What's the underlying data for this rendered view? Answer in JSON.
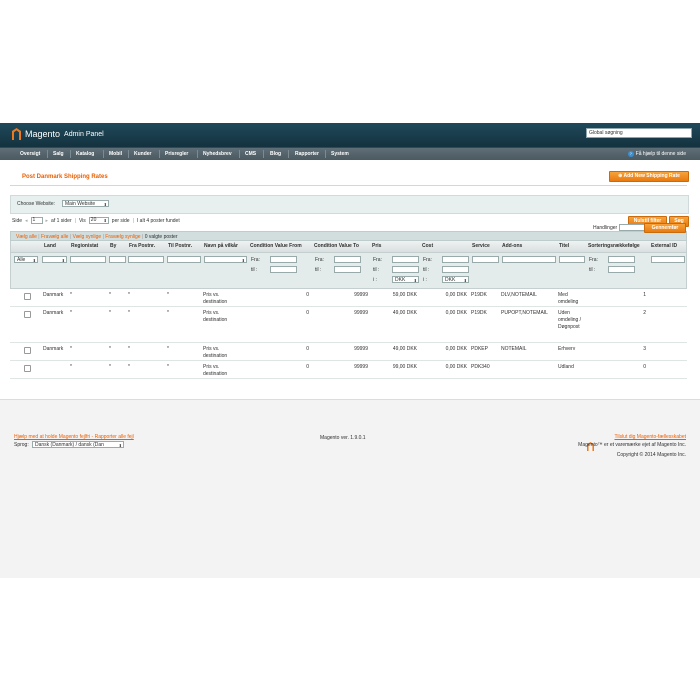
{
  "header": {
    "logo_text": "Magento",
    "logo_sub": "Admin Panel",
    "search_value": "Global søgning"
  },
  "nav": {
    "items": [
      "Oversigt",
      "Salg",
      "Katalog",
      "Mobil",
      "Kunder",
      "Prisregler",
      "Nyhedsbrev",
      "CMS",
      "Blog",
      "Rapporter",
      "System"
    ],
    "help": "Få hjælp til denne side"
  },
  "page": {
    "title": "Post Danmark Shipping Rates",
    "add_button": "Add New Shipping Rate"
  },
  "website": {
    "label": "Choose Website:",
    "selected": "Main Website"
  },
  "pager": {
    "side_label": "Side",
    "page_value": "1",
    "of_pages": "af 1 sider",
    "vis_label": "Vis",
    "per_page": "20",
    "per_page_suffix": "per side",
    "total": "I alt 4 poster fundet",
    "reset_button": "Nulstil filter",
    "search_button": "Søg"
  },
  "mass": {
    "select_all": "Vælg alle",
    "deselect_all": "Fravælg alle",
    "select_visible": "Vælg synlige",
    "deselect_visible": "Fravælg synlige",
    "selected_count": "0 valgte poster",
    "actions_label": "Handlinger",
    "submit": "Gennemfør"
  },
  "grid": {
    "columns": [
      "Land",
      "Regionistat",
      "By",
      "Fra Postnr.",
      "Til Postnr.",
      "Navn på vilkår",
      "Condition Value From",
      "Condition Value To",
      "Pris",
      "Cost",
      "Service",
      "Add-ons",
      "Titel",
      "Sorteringsrækkefølge",
      "External ID"
    ],
    "filter": {
      "land_select": "Alle",
      "from_label": "Fra:",
      "to_label": "til :",
      "currency_label": "i :",
      "currency": "DKK"
    },
    "rows": [
      {
        "land": "Danmark",
        "region": "*",
        "by": "*",
        "fra": "*",
        "til": "*",
        "navn": "Pris vs. destination",
        "cvf": "0",
        "cvt": "99999",
        "pris": "59,00 DKK",
        "cost": "0,00 DKK",
        "service": "P19DK",
        "addons": "DLV,NOTEMAIL",
        "titel": "Med omdeling",
        "sort": "1",
        "ext": ""
      },
      {
        "land": "Danmark",
        "region": "*",
        "by": "*",
        "fra": "*",
        "til": "*",
        "navn": "Pris vs. destination",
        "cvf": "0",
        "cvt": "99999",
        "pris": "49,00 DKK",
        "cost": "0,00 DKK",
        "service": "P19DK",
        "addons": "PUPOPT,NOTEMAIL",
        "titel": "Uden omdeling / Døgnpost",
        "sort": "2",
        "ext": ""
      },
      {
        "land": "Danmark",
        "region": "*",
        "by": "*",
        "fra": "*",
        "til": "*",
        "navn": "Pris vs. destination",
        "cvf": "0",
        "cvt": "99999",
        "pris": "49,00 DKK",
        "cost": "0,00 DKK",
        "service": "PDKEP",
        "addons": "NOTEMAIL",
        "titel": "Erhverv",
        "sort": "3",
        "ext": ""
      },
      {
        "land": "",
        "region": "*",
        "by": "*",
        "fra": "*",
        "til": "*",
        "navn": "Pris vs. destination",
        "cvf": "0",
        "cvt": "99999",
        "pris": "99,00 DKK",
        "cost": "0,00 DKK",
        "service": "PDK340",
        "addons": "",
        "titel": "Udland",
        "sort": "0",
        "ext": ""
      }
    ]
  },
  "footer": {
    "help_link": "Hjælp med at holde Magento fejlfri - Rapporter alle fejl",
    "version": "Magento ver. 1.9.0.1",
    "language_label": "Sprog:",
    "language_value": "Dansk (Danmark) / dansk (Dan",
    "connect_link": "Tilslut dig Magento-fællesskabet",
    "trademark": "Magento™ er et varemærke ejet af Magento Inc.",
    "copyright": "Copyright © 2014 Magento Inc."
  },
  "colors": {
    "accent": "#eb5e00",
    "header": "#1f4a5a"
  }
}
